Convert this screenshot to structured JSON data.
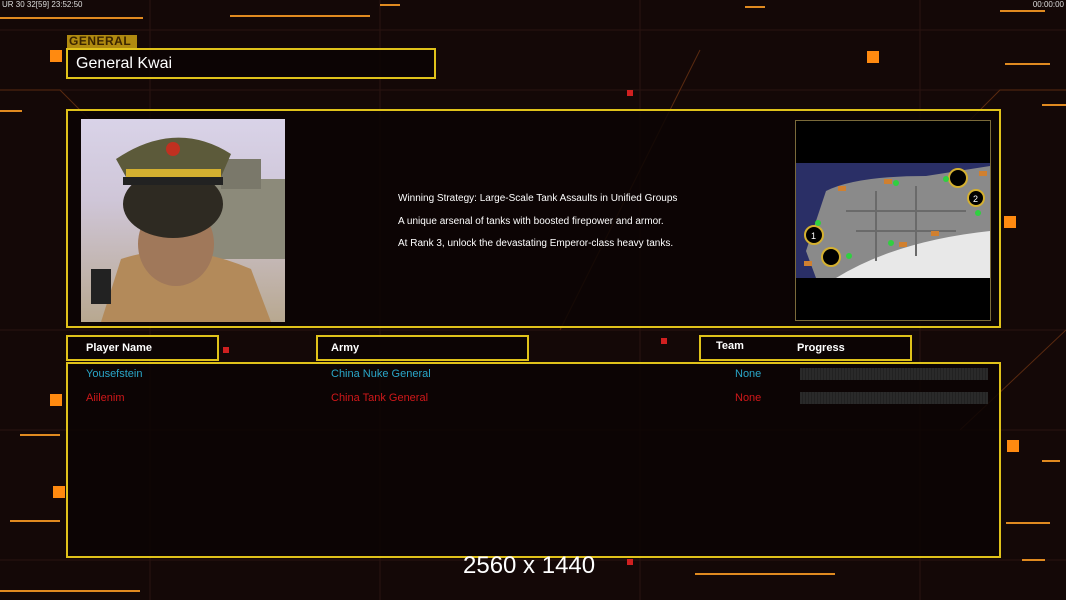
{
  "hud": {
    "left_info": "UR 30 32[59] 23:52:50",
    "right_clock": "00:00:00"
  },
  "general": {
    "tag": "GENERAL",
    "name": "General Kwai"
  },
  "description": [
    "Winning Strategy: Large-Scale Tank Assaults in Unified Groups",
    "A unique arsenal of tanks with boosted firepower and armor.",
    "At Rank 3, unlock the devastating Emperor-class heavy tanks."
  ],
  "minimap": {
    "start_positions": [
      "1",
      "2"
    ]
  },
  "table": {
    "headers": {
      "player": "Player Name",
      "army": "Army",
      "team": "Team",
      "progress": "Progress"
    },
    "rows": [
      {
        "player": "Yousefstein",
        "army": "China Nuke General",
        "team": "None",
        "progress": 0,
        "color": "#2aa6c8"
      },
      {
        "player": "Aiilenim",
        "army": "China Tank General",
        "team": "None",
        "progress": 0,
        "color": "#d0181a"
      }
    ]
  },
  "overlay": {
    "resolution": "2560 x 1440"
  },
  "colors": {
    "accent": "#e0c21a",
    "orange": "#ff8a10"
  }
}
